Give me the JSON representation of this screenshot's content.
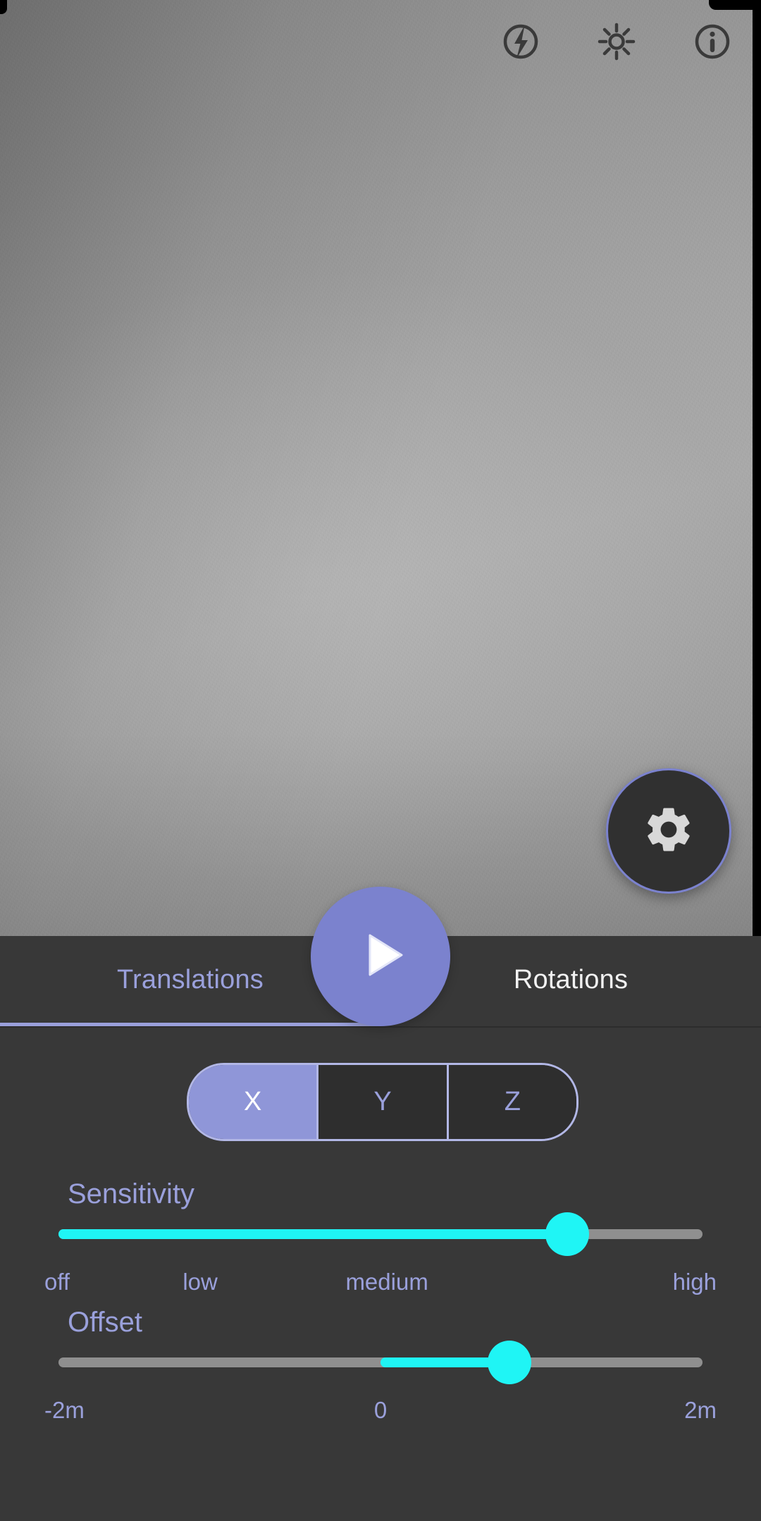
{
  "theme": {
    "accent_purple": "#9aa0db",
    "fab_purple": "#7b82ce",
    "slider_cyan": "#1ff5f5",
    "panel_bg": "#383838",
    "rail_gray": "#8f8f8f"
  },
  "camera": {
    "topbar_icons": [
      {
        "name": "flash-off-icon",
        "label": "Flash"
      },
      {
        "name": "brightness-icon",
        "label": "Brightness"
      },
      {
        "name": "info-icon",
        "label": "Info"
      }
    ],
    "settings_fab": {
      "icon": "gear-icon",
      "label": "Settings"
    }
  },
  "play_button": {
    "icon": "play-icon",
    "label": "Play"
  },
  "tabs": [
    {
      "label": "Translations",
      "active": true
    },
    {
      "label": "Rotations",
      "active": false
    }
  ],
  "axis_selector": {
    "options": [
      {
        "label": "X",
        "selected": true
      },
      {
        "label": "Y",
        "selected": false
      },
      {
        "label": "Z",
        "selected": false
      }
    ]
  },
  "sliders": [
    {
      "title": "Sensitivity",
      "mode": "from-start",
      "value_pct": 79,
      "fill_start_pct": 0,
      "ticks": [
        {
          "label": "off",
          "pos_pct": 0
        },
        {
          "label": "low",
          "pos_pct": 22
        },
        {
          "label": "medium",
          "pos_pct": 51
        },
        {
          "label": "high",
          "pos_pct": 100
        }
      ]
    },
    {
      "title": "Offset",
      "mode": "from-center",
      "value_pct": 70,
      "fill_start_pct": 50,
      "ticks": [
        {
          "label": "-2m",
          "pos_pct": 0
        },
        {
          "label": "0",
          "pos_pct": 50
        },
        {
          "label": "2m",
          "pos_pct": 100
        }
      ]
    }
  ]
}
